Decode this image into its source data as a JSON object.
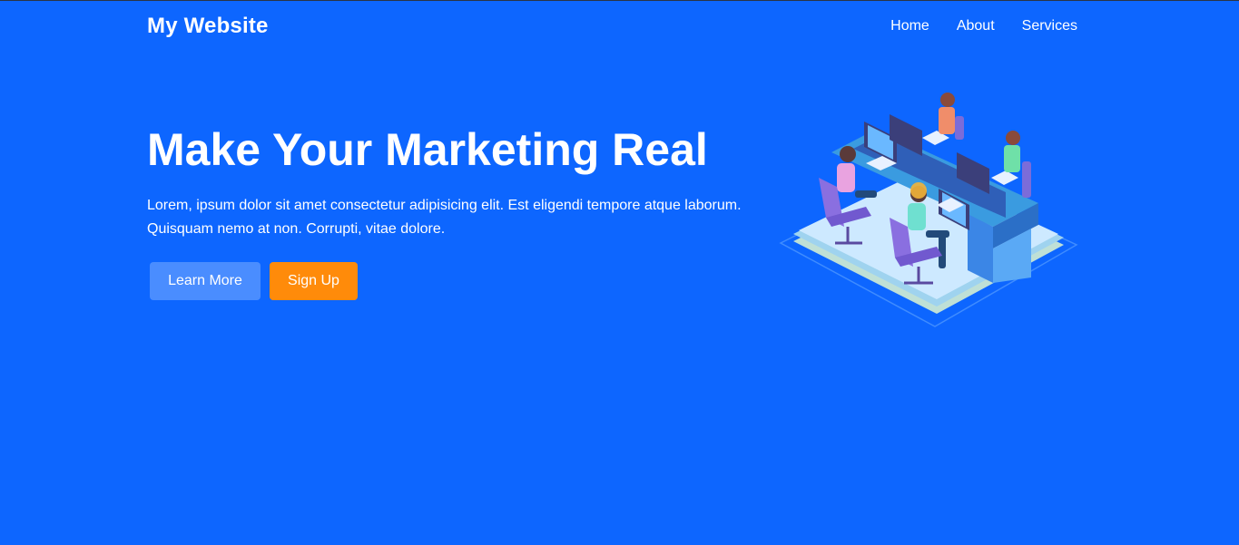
{
  "brand": "My Website",
  "nav": [
    {
      "label": "Home"
    },
    {
      "label": "About"
    },
    {
      "label": "Services"
    }
  ],
  "hero": {
    "title": "Make Your Marketing Real",
    "text": "Lorem, ipsum dolor sit amet consectetur adipisicing elit. Est eligendi tempore atque laborum. Quisquam nemo at non. Corrupti, vitae dolore.",
    "buttons": {
      "learn_more": "Learn More",
      "sign_up": "Sign Up"
    }
  },
  "colors": {
    "background": "#0d66ff",
    "learn_button": "#4a8dff",
    "signup_button": "#ff8b0a"
  },
  "illustration": {
    "icon": "office-team-isometric-illustration"
  }
}
